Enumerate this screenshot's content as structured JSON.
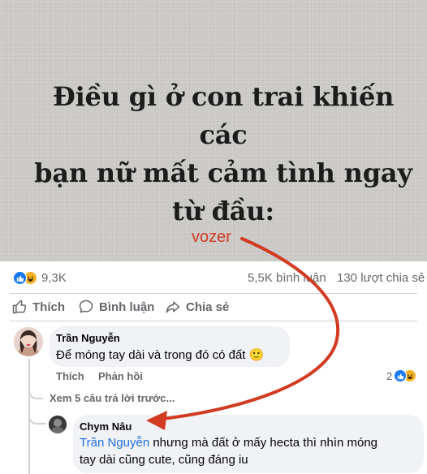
{
  "post": {
    "headline_lines": [
      "Điều gì ở con trai khiến các",
      "bạn nữ mất cảm tình ngay",
      "từ đầu:"
    ],
    "watermark": "vozer"
  },
  "stats": {
    "reaction_count": "9,3K",
    "comments": "5,5K bình luận",
    "shares": "130 lượt chia sẻ"
  },
  "actions": {
    "like": "Thích",
    "comment": "Bình luận",
    "share": "Chia sẻ"
  },
  "comment1": {
    "author": "Trần Nguyễn",
    "text": "Để móng tay dài và trong đó có đất",
    "emoji": "🙂",
    "like": "Thích",
    "reply": "Phản hồi",
    "reaction_count": "2"
  },
  "view_replies": "Xem 5 câu trả lời trước...",
  "reply1": {
    "author": "Chym Nâu",
    "mention": "Trần Nguyễn",
    "line1": " nhưng mà đất ở mấy hecta thì nhìn móng",
    "line2": "tay dài cũng cute, cũng đáng iu"
  },
  "colors": {
    "annotation_arrow": "#d23a22",
    "like_blue": "#1877f2",
    "haha_yellow": "#f7b125",
    "mention_blue": "#216fdb"
  }
}
